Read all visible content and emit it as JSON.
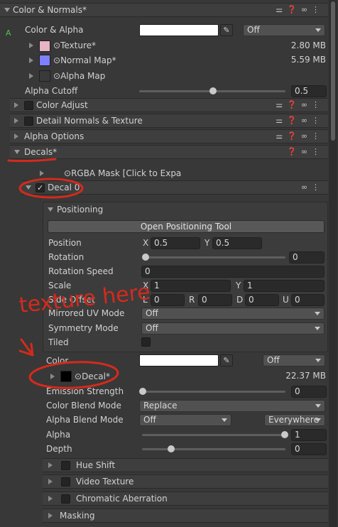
{
  "color_normals": {
    "title": "Color & Normals*",
    "color_alpha_label": "Color & Alpha",
    "color_alpha_mode": "Off",
    "texture_label": "Texture*",
    "texture_size": "2.80 MB",
    "normal_map_label": "Normal Map*",
    "normal_map_size": "5.59 MB",
    "alpha_map_label": "Alpha Map",
    "alpha_cutoff_label": "Alpha Cutoff",
    "alpha_cutoff_value": "0.5"
  },
  "sections": {
    "color_adjust": "Color Adjust",
    "detail_normals": "Detail Normals & Texture",
    "alpha_options": "Alpha Options",
    "decals": "Decals*",
    "rgba_mask": "RGBA Mask [Click to Expa",
    "decal0": "Decal 0"
  },
  "positioning": {
    "title": "Positioning",
    "open_tool": "Open Positioning Tool",
    "position_label": "Position",
    "pos_x": "0.5",
    "pos_y": "0.5",
    "rotation_label": "Rotation",
    "rotation_value": "0",
    "rotation_speed_label": "Rotation Speed",
    "rotation_speed_value": "0",
    "scale_label": "Scale",
    "scale_x": "1",
    "scale_y": "1",
    "side_offset_label": "Side Offset",
    "side_l": "0",
    "side_r": "0",
    "side_d": "0",
    "side_u": "0",
    "mirrored_label": "Mirrored UV Mode",
    "mirrored_value": "Off",
    "symmetry_label": "Symmetry Mode",
    "symmetry_value": "Off",
    "tiled_label": "Tiled",
    "axis_x": "X",
    "axis_y": "Y",
    "axis_l": "L",
    "axis_r": "R",
    "axis_d": "D",
    "axis_u": "U"
  },
  "decal": {
    "color_label": "Color",
    "color_mode": "Off",
    "decal_label": "Decal*",
    "decal_size": "22.37 MB",
    "emission_label": "Emission Strength",
    "emission_value": "0",
    "color_blend_label": "Color Blend Mode",
    "color_blend_value": "Replace",
    "alpha_blend_label": "Alpha Blend Mode",
    "alpha_blend_value": "Off",
    "alpha_blend_scope": "Everywhere",
    "alpha_label": "Alpha",
    "alpha_value": "1",
    "depth_label": "Depth",
    "depth_value": "0"
  },
  "subsections": {
    "hue_shift": "Hue Shift",
    "video_texture": "Video Texture",
    "chromatic": "Chromatic Aberration",
    "masking": "Masking"
  },
  "annotation_text": "texture here",
  "side_letter": "A",
  "colors": {
    "annotation": "#d42a1c",
    "accent": "#4cc24c",
    "panel": "#383838",
    "header": "#3e3e3e"
  }
}
